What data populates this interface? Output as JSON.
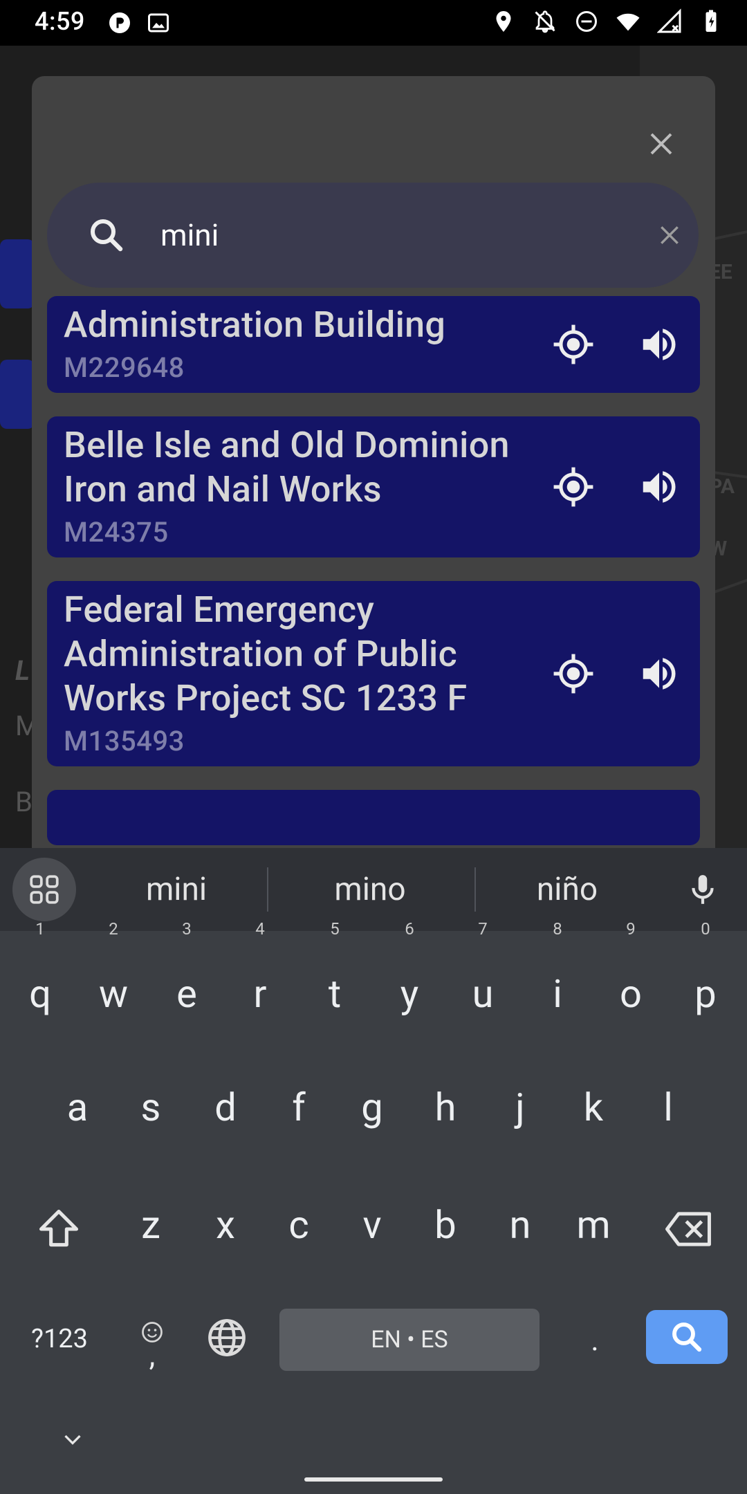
{
  "status_bar": {
    "time": "4:59",
    "left_icons": [
      "media-icon",
      "photo-icon"
    ],
    "right_icons": [
      "location-icon",
      "bell-off-icon",
      "dnd-icon",
      "wifi-icon",
      "signal-icon",
      "battery-icon"
    ]
  },
  "dialog": {
    "close_icon": "close-icon",
    "search": {
      "value": "mini",
      "icon": "search-icon",
      "clear_icon": "clear-icon"
    },
    "results": [
      {
        "title": "Administration Building",
        "id": "M229648"
      },
      {
        "title": "Belle Isle and Old Dominion Iron and Nail Works",
        "id": "M24375"
      },
      {
        "title": "Federal Emergency Administration of Public Works Project SC 1233 F",
        "id": "M135493"
      }
    ]
  },
  "keyboard": {
    "suggestions": [
      "mini",
      "mino",
      "niño"
    ],
    "row1": [
      {
        "k": "q",
        "h": "1"
      },
      {
        "k": "w",
        "h": "2"
      },
      {
        "k": "e",
        "h": "3"
      },
      {
        "k": "r",
        "h": "4"
      },
      {
        "k": "t",
        "h": "5"
      },
      {
        "k": "y",
        "h": "6"
      },
      {
        "k": "u",
        "h": "7"
      },
      {
        "k": "i",
        "h": "8"
      },
      {
        "k": "o",
        "h": "9"
      },
      {
        "k": "p",
        "h": "0"
      }
    ],
    "row2": [
      "a",
      "s",
      "d",
      "f",
      "g",
      "h",
      "j",
      "k",
      "l"
    ],
    "row3": [
      "z",
      "x",
      "c",
      "v",
      "b",
      "n",
      "m"
    ],
    "symbols_label": "?123",
    "comma_label": ",",
    "space_label": "EN • ES",
    "period_label": "."
  },
  "colors": {
    "card_bg": "#141466",
    "dialog_bg": "#424242",
    "enter_key": "#5f9cf3"
  }
}
